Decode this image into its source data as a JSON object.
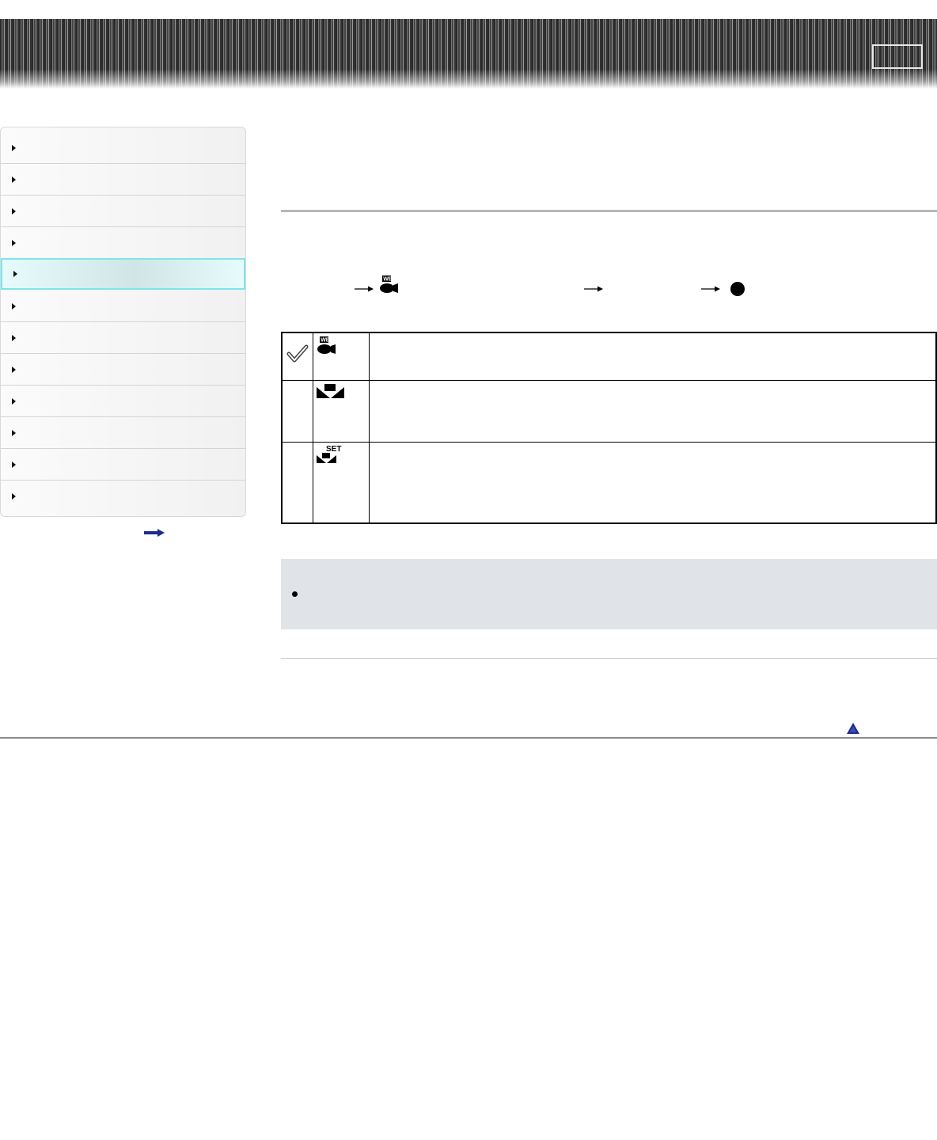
{
  "header": {
    "button_label": ""
  },
  "sidebar": {
    "items": [
      {
        "label": ""
      },
      {
        "label": ""
      },
      {
        "label": ""
      },
      {
        "label": ""
      },
      {
        "label": "",
        "active": true
      },
      {
        "label": ""
      },
      {
        "label": ""
      },
      {
        "label": ""
      },
      {
        "label": ""
      },
      {
        "label": ""
      },
      {
        "label": ""
      },
      {
        "label": ""
      }
    ],
    "more_icon": "right-arrow-icon"
  },
  "page": {
    "title": "",
    "steps": {
      "icons": [
        "right-arrow-icon",
        "movie-wb-icon",
        "right-arrow-icon",
        "right-arrow-icon",
        "center-button-icon"
      ],
      "text_1": "",
      "text_2": "",
      "text_3": ""
    }
  },
  "options": [
    {
      "icon": "movie-wb-icon",
      "selected": true,
      "text": ""
    },
    {
      "icon": "one-push-wb-icon",
      "selected": false,
      "text": ""
    },
    {
      "icon": "one-push-set-icon",
      "selected": false,
      "text": "",
      "icon_label": "SET"
    }
  ],
  "note": {
    "text": ""
  },
  "footer": {
    "top_link_icon": "page-top-icon"
  },
  "colors": {
    "accent_border": "#7fe3ec",
    "note_background": "#e0e3e8",
    "link": "#1f2a8c"
  }
}
